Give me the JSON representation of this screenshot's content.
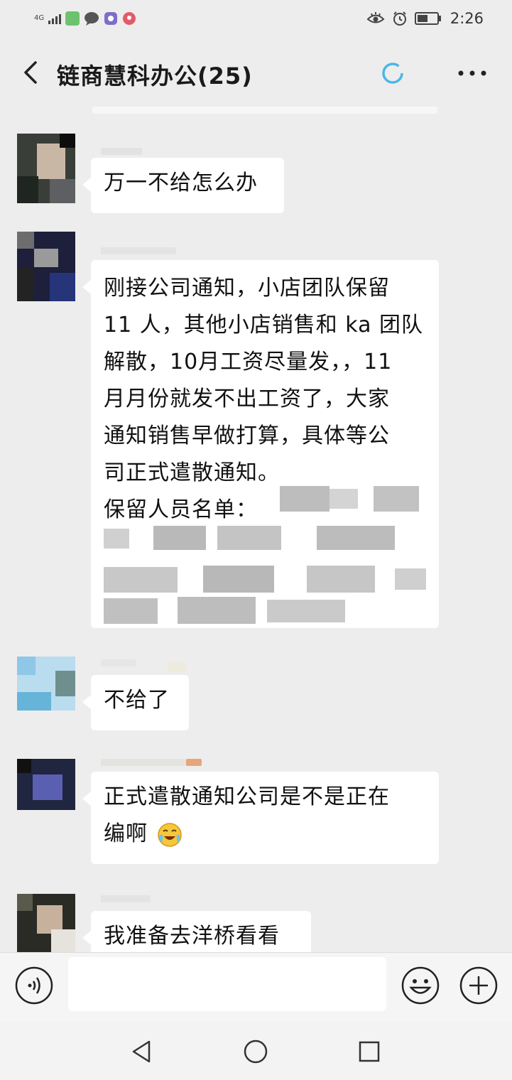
{
  "status_bar": {
    "network": "4G",
    "time": "2:26",
    "icons": [
      "signal-icon",
      "app-icon",
      "chat-notification-icon",
      "browser-icon",
      "map-icon",
      "eye-icon",
      "alarm-icon",
      "battery-icon"
    ]
  },
  "header": {
    "title": "链商慧科办公(25)",
    "back_icon": "chevron-left-icon",
    "status_icon": "loading-ring-icon",
    "more_icon": "more-dots-icon"
  },
  "messages": [
    {
      "text": "万一不给怎么办"
    },
    {
      "lines": [
        "刚接公司通知，小店团队保留",
        "11 人，其他小店销售和 ka 团队",
        "解散，10月工资尽量发，，11",
        "月月份就发不出工资了，大家",
        "通知销售早做打算，具体等公",
        "司正式遣散通知。"
      ],
      "list_label": "保留人员名单："
    },
    {
      "text": "不给了"
    },
    {
      "lines": [
        "正式遣散通知公司是不是正在",
        "编啊"
      ],
      "emoji": "crying-laughing-face"
    },
    {
      "text": "我准备去洋桥看看"
    }
  ],
  "input_bar": {
    "voice_icon": "voice-icon",
    "emoji_icon": "emoji-icon",
    "plus_icon": "plus-icon"
  },
  "nav_bar": {
    "icons": [
      "back-triangle-icon",
      "home-circle-icon",
      "recent-square-icon"
    ]
  },
  "colors": {
    "background": "#ededed",
    "bubble": "#ffffff",
    "loader_accent": "#49b6e8"
  }
}
